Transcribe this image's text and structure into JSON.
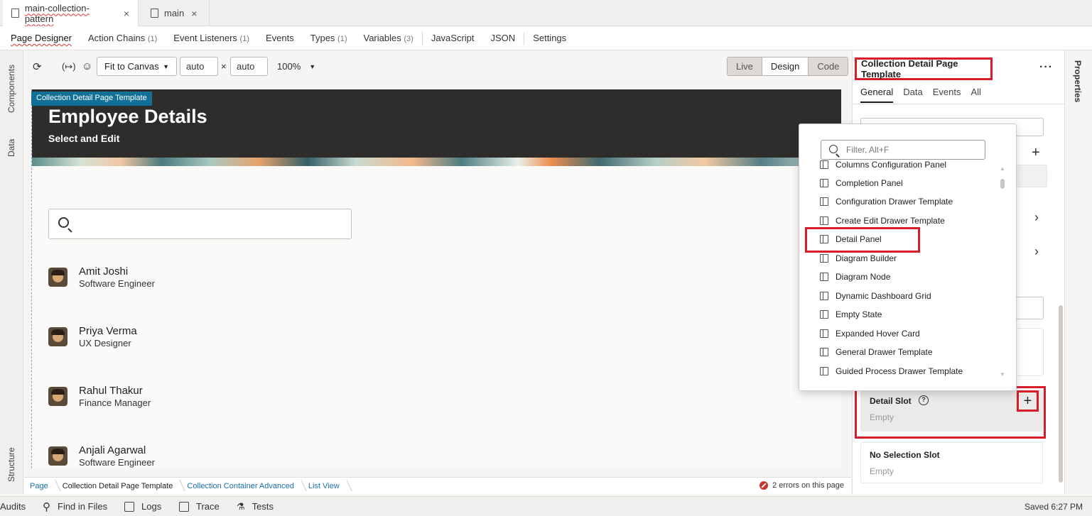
{
  "file_tabs": [
    {
      "label": "main-collection-pattern",
      "close": "×"
    },
    {
      "label": "main",
      "close": "×"
    }
  ],
  "designer_nav": {
    "page_designer": "Page Designer",
    "action_chains": "Action Chains",
    "action_chains_count": "(1)",
    "event_listeners": "Event Listeners",
    "event_listeners_count": "(1)",
    "events": "Events",
    "types": "Types",
    "types_count": "(1)",
    "variables": "Variables",
    "variables_count": "(3)",
    "javascript": "JavaScript",
    "json": "JSON",
    "settings": "Settings"
  },
  "left_rail": {
    "components": "Components",
    "data": "Data",
    "structure": "Structure"
  },
  "right_rail": {
    "properties": "Properties"
  },
  "toolbar": {
    "fit": "Fit to Canvas",
    "width": "auto",
    "times": "×",
    "height": "auto",
    "zoom": "100%",
    "modes": [
      "Live",
      "Design",
      "Code"
    ]
  },
  "canvas": {
    "template_tag": "Collection Detail Page Template",
    "title": "Employee Details",
    "subtitle": "Select and Edit",
    "employees": [
      {
        "name": "Amit Joshi",
        "role": "Software Engineer"
      },
      {
        "name": "Priya Verma",
        "role": "UX Designer"
      },
      {
        "name": "Rahul Thakur",
        "role": "Finance Manager"
      },
      {
        "name": "Anjali Agarwal",
        "role": "Software Engineer"
      }
    ]
  },
  "breadcrumbs": [
    "Page",
    "Collection Detail Page Template",
    "Collection Container Advanced",
    "List View"
  ],
  "errors": "2 errors on this page",
  "statusbar": {
    "audits": "Audits",
    "find": "Find in Files",
    "logs": "Logs",
    "trace": "Trace",
    "tests": "Tests",
    "saved": "Saved 6:27 PM"
  },
  "properties": {
    "title": "Collection Detail Page Template",
    "more": "···",
    "tabs": [
      "General",
      "Data",
      "Events",
      "All"
    ],
    "detail_slot": {
      "title": "Detail Slot",
      "help": "?",
      "value": "Empty",
      "add": "+"
    },
    "no_selection_slot": {
      "title": "No Selection Slot",
      "value": "Empty"
    }
  },
  "popup": {
    "filter_placeholder": "Filter, Alt+F",
    "items": [
      "Columns Configuration Panel",
      "Completion Panel",
      "Configuration Drawer Template",
      "Create Edit Drawer Template",
      "Detail Panel",
      "Diagram Builder",
      "Diagram Node",
      "Dynamic Dashboard Grid",
      "Empty State",
      "Expanded Hover Card",
      "General Drawer Template",
      "Guided Process Drawer Template"
    ]
  },
  "colors": {
    "accent_red": "#d51e2a",
    "template_tag": "#107098",
    "banner": "#2f2d2b"
  }
}
